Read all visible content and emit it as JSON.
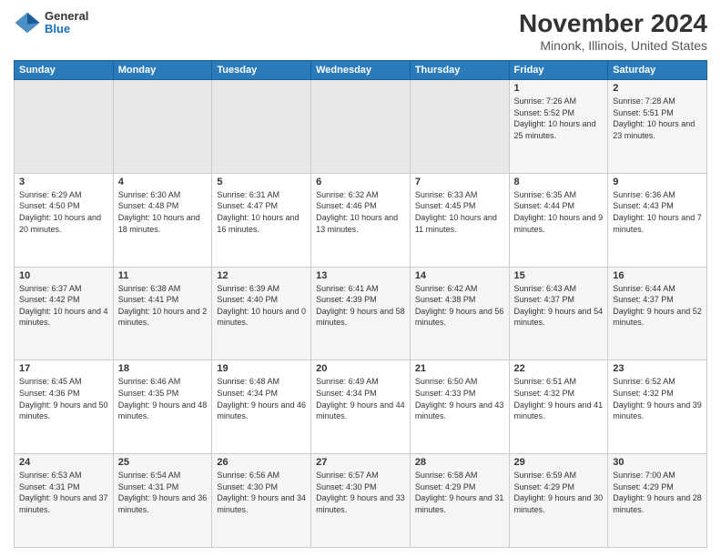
{
  "header": {
    "logo": {
      "general": "General",
      "blue": "Blue"
    },
    "title": "November 2024",
    "subtitle": "Minonk, Illinois, United States"
  },
  "weekdays": [
    "Sunday",
    "Monday",
    "Tuesday",
    "Wednesday",
    "Thursday",
    "Friday",
    "Saturday"
  ],
  "weeks": [
    [
      {
        "day": "",
        "empty": true
      },
      {
        "day": "",
        "empty": true
      },
      {
        "day": "",
        "empty": true
      },
      {
        "day": "",
        "empty": true
      },
      {
        "day": "",
        "empty": true
      },
      {
        "day": "1",
        "sunrise": "Sunrise: 7:26 AM",
        "sunset": "Sunset: 5:52 PM",
        "daylight": "Daylight: 10 hours and 25 minutes."
      },
      {
        "day": "2",
        "sunrise": "Sunrise: 7:28 AM",
        "sunset": "Sunset: 5:51 PM",
        "daylight": "Daylight: 10 hours and 23 minutes."
      }
    ],
    [
      {
        "day": "3",
        "sunrise": "Sunrise: 6:29 AM",
        "sunset": "Sunset: 4:50 PM",
        "daylight": "Daylight: 10 hours and 20 minutes."
      },
      {
        "day": "4",
        "sunrise": "Sunrise: 6:30 AM",
        "sunset": "Sunset: 4:48 PM",
        "daylight": "Daylight: 10 hours and 18 minutes."
      },
      {
        "day": "5",
        "sunrise": "Sunrise: 6:31 AM",
        "sunset": "Sunset: 4:47 PM",
        "daylight": "Daylight: 10 hours and 16 minutes."
      },
      {
        "day": "6",
        "sunrise": "Sunrise: 6:32 AM",
        "sunset": "Sunset: 4:46 PM",
        "daylight": "Daylight: 10 hours and 13 minutes."
      },
      {
        "day": "7",
        "sunrise": "Sunrise: 6:33 AM",
        "sunset": "Sunset: 4:45 PM",
        "daylight": "Daylight: 10 hours and 11 minutes."
      },
      {
        "day": "8",
        "sunrise": "Sunrise: 6:35 AM",
        "sunset": "Sunset: 4:44 PM",
        "daylight": "Daylight: 10 hours and 9 minutes."
      },
      {
        "day": "9",
        "sunrise": "Sunrise: 6:36 AM",
        "sunset": "Sunset: 4:43 PM",
        "daylight": "Daylight: 10 hours and 7 minutes."
      }
    ],
    [
      {
        "day": "10",
        "sunrise": "Sunrise: 6:37 AM",
        "sunset": "Sunset: 4:42 PM",
        "daylight": "Daylight: 10 hours and 4 minutes."
      },
      {
        "day": "11",
        "sunrise": "Sunrise: 6:38 AM",
        "sunset": "Sunset: 4:41 PM",
        "daylight": "Daylight: 10 hours and 2 minutes."
      },
      {
        "day": "12",
        "sunrise": "Sunrise: 6:39 AM",
        "sunset": "Sunset: 4:40 PM",
        "daylight": "Daylight: 10 hours and 0 minutes."
      },
      {
        "day": "13",
        "sunrise": "Sunrise: 6:41 AM",
        "sunset": "Sunset: 4:39 PM",
        "daylight": "Daylight: 9 hours and 58 minutes."
      },
      {
        "day": "14",
        "sunrise": "Sunrise: 6:42 AM",
        "sunset": "Sunset: 4:38 PM",
        "daylight": "Daylight: 9 hours and 56 minutes."
      },
      {
        "day": "15",
        "sunrise": "Sunrise: 6:43 AM",
        "sunset": "Sunset: 4:37 PM",
        "daylight": "Daylight: 9 hours and 54 minutes."
      },
      {
        "day": "16",
        "sunrise": "Sunrise: 6:44 AM",
        "sunset": "Sunset: 4:37 PM",
        "daylight": "Daylight: 9 hours and 52 minutes."
      }
    ],
    [
      {
        "day": "17",
        "sunrise": "Sunrise: 6:45 AM",
        "sunset": "Sunset: 4:36 PM",
        "daylight": "Daylight: 9 hours and 50 minutes."
      },
      {
        "day": "18",
        "sunrise": "Sunrise: 6:46 AM",
        "sunset": "Sunset: 4:35 PM",
        "daylight": "Daylight: 9 hours and 48 minutes."
      },
      {
        "day": "19",
        "sunrise": "Sunrise: 6:48 AM",
        "sunset": "Sunset: 4:34 PM",
        "daylight": "Daylight: 9 hours and 46 minutes."
      },
      {
        "day": "20",
        "sunrise": "Sunrise: 6:49 AM",
        "sunset": "Sunset: 4:34 PM",
        "daylight": "Daylight: 9 hours and 44 minutes."
      },
      {
        "day": "21",
        "sunrise": "Sunrise: 6:50 AM",
        "sunset": "Sunset: 4:33 PM",
        "daylight": "Daylight: 9 hours and 43 minutes."
      },
      {
        "day": "22",
        "sunrise": "Sunrise: 6:51 AM",
        "sunset": "Sunset: 4:32 PM",
        "daylight": "Daylight: 9 hours and 41 minutes."
      },
      {
        "day": "23",
        "sunrise": "Sunrise: 6:52 AM",
        "sunset": "Sunset: 4:32 PM",
        "daylight": "Daylight: 9 hours and 39 minutes."
      }
    ],
    [
      {
        "day": "24",
        "sunrise": "Sunrise: 6:53 AM",
        "sunset": "Sunset: 4:31 PM",
        "daylight": "Daylight: 9 hours and 37 minutes."
      },
      {
        "day": "25",
        "sunrise": "Sunrise: 6:54 AM",
        "sunset": "Sunset: 4:31 PM",
        "daylight": "Daylight: 9 hours and 36 minutes."
      },
      {
        "day": "26",
        "sunrise": "Sunrise: 6:56 AM",
        "sunset": "Sunset: 4:30 PM",
        "daylight": "Daylight: 9 hours and 34 minutes."
      },
      {
        "day": "27",
        "sunrise": "Sunrise: 6:57 AM",
        "sunset": "Sunset: 4:30 PM",
        "daylight": "Daylight: 9 hours and 33 minutes."
      },
      {
        "day": "28",
        "sunrise": "Sunrise: 6:58 AM",
        "sunset": "Sunset: 4:29 PM",
        "daylight": "Daylight: 9 hours and 31 minutes."
      },
      {
        "day": "29",
        "sunrise": "Sunrise: 6:59 AM",
        "sunset": "Sunset: 4:29 PM",
        "daylight": "Daylight: 9 hours and 30 minutes."
      },
      {
        "day": "30",
        "sunrise": "Sunrise: 7:00 AM",
        "sunset": "Sunset: 4:29 PM",
        "daylight": "Daylight: 9 hours and 28 minutes."
      }
    ]
  ]
}
